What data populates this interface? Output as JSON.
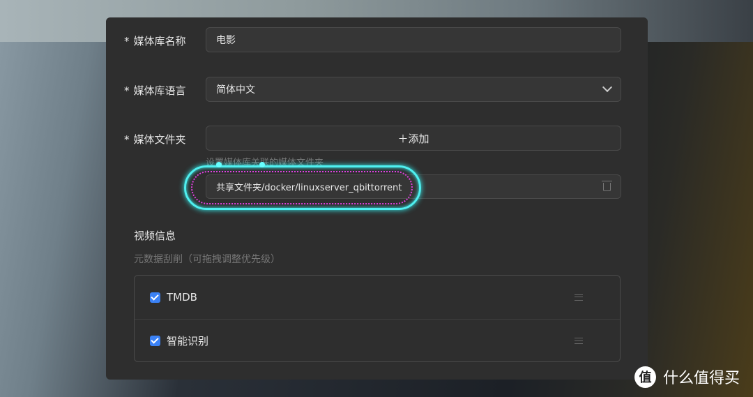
{
  "form": {
    "name_label": "媒体库名称",
    "name_value": "电影",
    "lang_label": "媒体库语言",
    "lang_value": "简体中文",
    "folder_label": "媒体文件夹",
    "add_button": "＋添加",
    "folder_hint": "设置媒体库关联的媒体文件夹",
    "folder_path": "共享文件夹/docker/linuxserver_qbittorrent",
    "required_mark": "*"
  },
  "video": {
    "title": "视频信息",
    "subtitle": "元数据刮削（可拖拽调整优先级）",
    "items": [
      {
        "label": "TMDB",
        "checked": true
      },
      {
        "label": "智能识别",
        "checked": true
      }
    ]
  },
  "watermark": {
    "logo": "值",
    "text": "什么值得买"
  },
  "colors": {
    "highlight": "#4ff0f0",
    "dotted": "#e040e0",
    "checkbox": "#3b82f6"
  }
}
